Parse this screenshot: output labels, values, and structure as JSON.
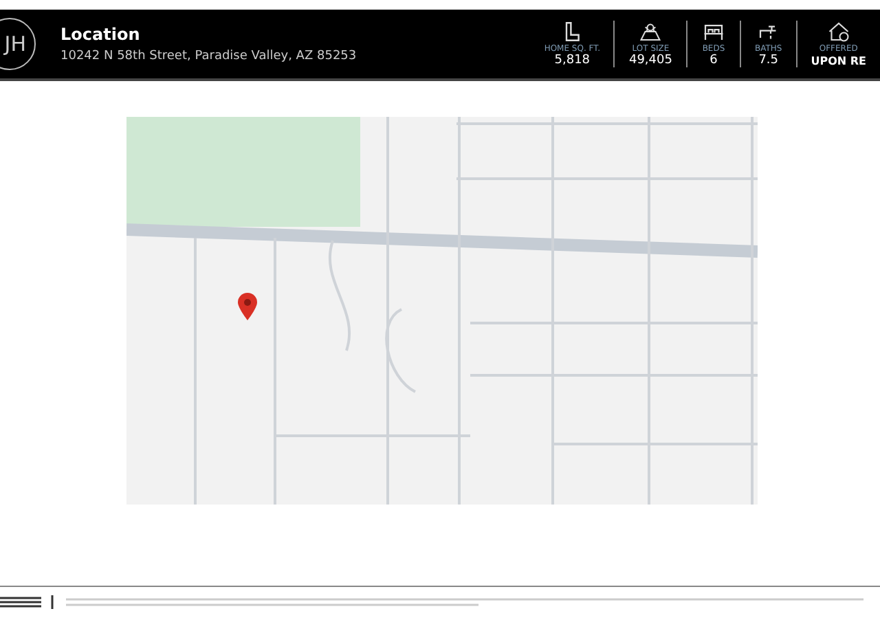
{
  "header": {
    "logo": "JH",
    "title": "Location",
    "address": "10242 N 58th Street, Paradise Valley, AZ 85253"
  },
  "stats": [
    {
      "kind": "area",
      "label": "HOME SQ. FT.",
      "value": "5,818"
    },
    {
      "kind": "lot",
      "label": "LOT SIZE",
      "value": "49,405"
    },
    {
      "kind": "beds",
      "label": "BEDS",
      "value": "6"
    },
    {
      "kind": "baths",
      "label": "BATHS",
      "value": "7.5"
    },
    {
      "kind": "price",
      "label": "OFFERED",
      "value": "UPON RE"
    }
  ]
}
